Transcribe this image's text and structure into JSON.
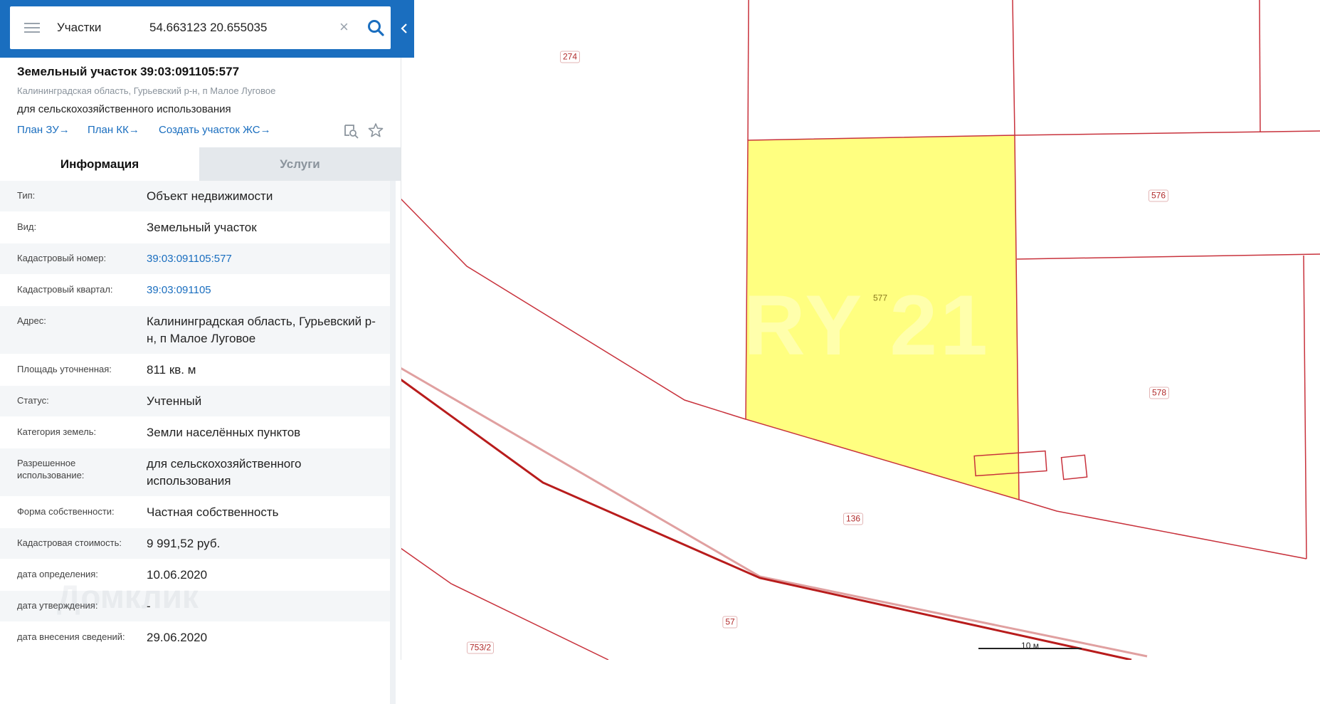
{
  "search": {
    "layer": "Участки",
    "query": "54.663123 20.655035",
    "icons": {
      "menu": "menu-icon",
      "clear": "close-icon",
      "search": "search-icon",
      "collapse": "chevron-left-icon"
    }
  },
  "card": {
    "title": "Земельный участок 39:03:091105:577",
    "address": "Калининградская область, Гурьевский р-н, п Малое Луговое",
    "purpose": "для сельскохозяйственного использования",
    "links": [
      "План ЗУ",
      "План КК",
      "Создать участок ЖС"
    ],
    "link_arrow": "→",
    "icons": {
      "find": "find-on-map-icon",
      "favorite": "star-icon"
    }
  },
  "tabs": [
    "Информация",
    "Услуги"
  ],
  "info": [
    {
      "key": "Тип:",
      "value": "Объект недвижимости"
    },
    {
      "key": "Вид:",
      "value": "Земельный участок"
    },
    {
      "key": "Кадастровый номер:",
      "value": "39:03:091105:577",
      "link": true
    },
    {
      "key": "Кадастровый квартал:",
      "value": "39:03:091105",
      "link": true
    },
    {
      "key": "Адрес:",
      "value": "Калининградская область, Гурьевский р-н, п Малое Луговое"
    },
    {
      "key": "Площадь уточненная:",
      "value": "811 кв. м"
    },
    {
      "key": "Статус:",
      "value": "Учтенный"
    },
    {
      "key": "Категория земель:",
      "value": "Земли населённых пунктов"
    },
    {
      "key": "Разрешенное использование:",
      "value": "для сельскохозяйственного использования"
    },
    {
      "key": "Форма собственности:",
      "value": "Частная собственность"
    },
    {
      "key": "Кадастровая стоимость:",
      "value": "9 991,52 руб."
    },
    {
      "key": "дата определения:",
      "value": "10.06.2020"
    },
    {
      "key": "дата утверждения:",
      "value": "-"
    },
    {
      "key": "дата внесения сведений:",
      "value": "29.06.2020"
    }
  ],
  "map": {
    "plot_labels": [
      "274",
      "576",
      "577",
      "578",
      "136",
      "57",
      "753/2"
    ],
    "selected_plot": "577",
    "scale_label": "10 м",
    "colors": {
      "boundary": "#c8323c",
      "selected_fill": "#ffff80",
      "road": "#b81c1c",
      "road_light": "#e0a0a0"
    }
  },
  "watermarks": [
    "RY 21",
    "Домклик"
  ]
}
